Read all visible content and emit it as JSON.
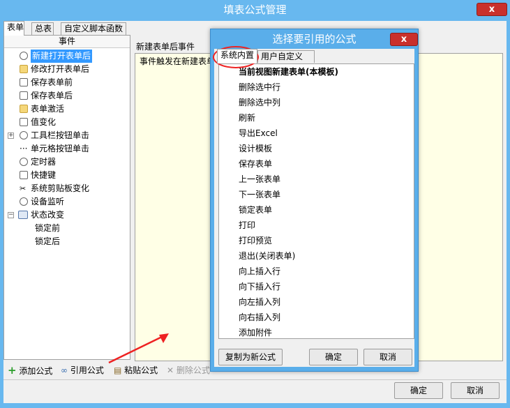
{
  "window": {
    "title": "填表公式管理",
    "close_label": "x"
  },
  "tabs": [
    {
      "label": "表单"
    },
    {
      "label": "总表"
    },
    {
      "label": "自定义脚本函数"
    }
  ],
  "tree": {
    "header": "事件",
    "items": [
      {
        "label": "新建打开表单后"
      },
      {
        "label": "修改打开表单后"
      },
      {
        "label": "保存表单前"
      },
      {
        "label": "保存表单后"
      },
      {
        "label": "表单激活"
      },
      {
        "label": "值变化"
      },
      {
        "label": "工具栏按钮单击"
      },
      {
        "label": "单元格按钮单击"
      },
      {
        "label": "定时器"
      },
      {
        "label": "快捷键"
      },
      {
        "label": "系统剪贴板变化"
      },
      {
        "label": "设备监听"
      },
      {
        "label": "状态改变"
      },
      {
        "label": "锁定前"
      },
      {
        "label": "锁定后"
      }
    ]
  },
  "event_panel": {
    "title": "新建表单后事件",
    "description": "事件触发在新建表单"
  },
  "actions": {
    "add": "添加公式",
    "reference": "引用公式",
    "paste": "粘贴公式",
    "delete": "删除公式"
  },
  "footer": {
    "ok": "确定",
    "cancel": "取消"
  },
  "dialog": {
    "title": "选择要引用的公式",
    "close_label": "x",
    "tabs": [
      {
        "label": "系统内置"
      },
      {
        "label": "用户自定义"
      }
    ],
    "items": [
      {
        "label": "当前视图新建表单(本模板)"
      },
      {
        "label": "删除选中行"
      },
      {
        "label": "删除选中列"
      },
      {
        "label": "刷新"
      },
      {
        "label": "导出Excel"
      },
      {
        "label": "设计模板"
      },
      {
        "label": "保存表单"
      },
      {
        "label": "上一张表单"
      },
      {
        "label": "下一张表单"
      },
      {
        "label": "锁定表单"
      },
      {
        "label": "打印"
      },
      {
        "label": "打印预览"
      },
      {
        "label": "退出(关闭表单)"
      },
      {
        "label": "向上插入行"
      },
      {
        "label": "向下插入行"
      },
      {
        "label": "向左插入列"
      },
      {
        "label": "向右插入列"
      },
      {
        "label": "添加附件"
      }
    ],
    "copy_button": "复制为新公式",
    "ok": "确定",
    "cancel": "取消"
  },
  "colors": {
    "title_bar": "#68b8ef",
    "close": "#c9302c",
    "selection": "#3399ff",
    "highlight": "#e22222"
  }
}
